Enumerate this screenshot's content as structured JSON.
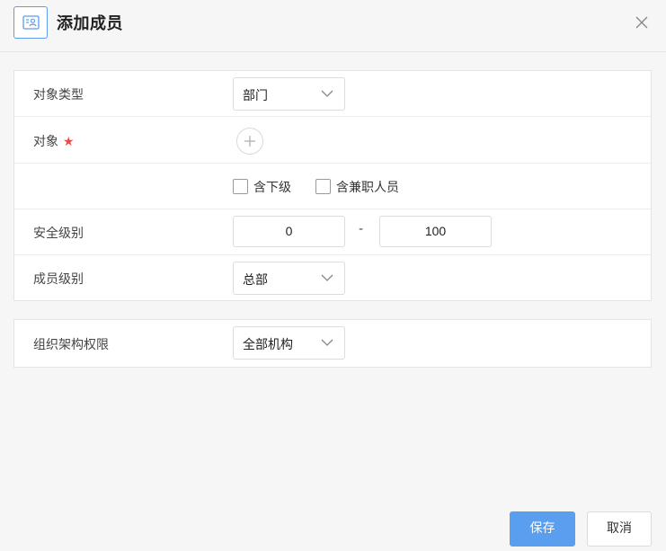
{
  "dialog": {
    "title": "添加成员",
    "icons": {
      "header": "contact-card-icon",
      "close": "close-icon"
    }
  },
  "form": {
    "object_type": {
      "label": "对象类型",
      "value": "部门"
    },
    "object": {
      "label": "对象",
      "required_mark": "★",
      "add_icon": "plus-icon"
    },
    "options": {
      "include_sub": "含下级",
      "include_parttime": "含兼职人员"
    },
    "security_level": {
      "label": "安全级别",
      "min": "0",
      "separator": "-",
      "max": "100"
    },
    "member_level": {
      "label": "成员级别",
      "value": "总部"
    },
    "org_permission": {
      "label": "组织架构权限",
      "value": "全部机构"
    }
  },
  "footer": {
    "save": "保存",
    "cancel": "取消"
  }
}
